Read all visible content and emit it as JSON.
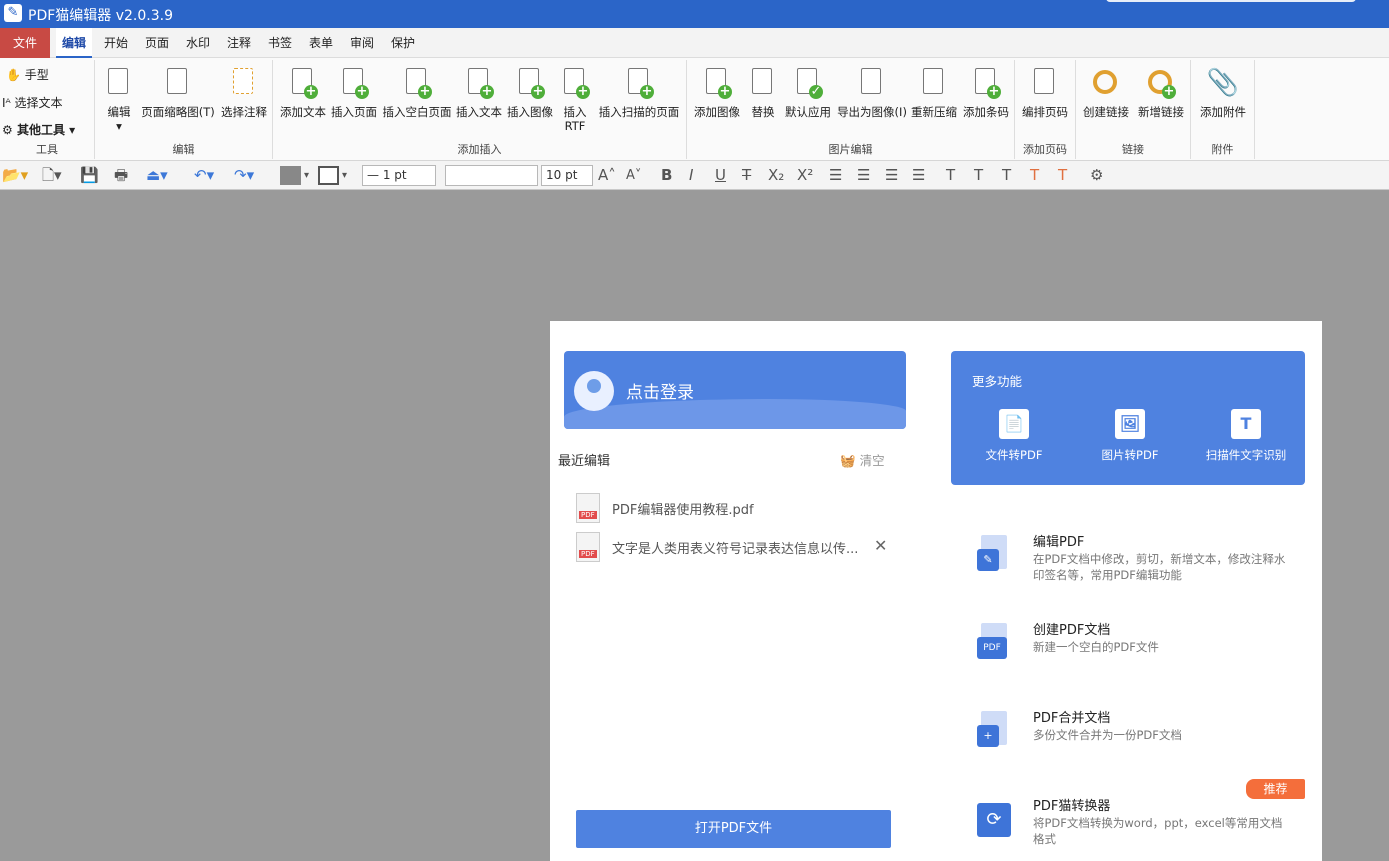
{
  "window": {
    "title": "PDF猫编辑器 v2.0.3.9"
  },
  "menu": {
    "tabs": [
      "文件",
      "编辑",
      "开始",
      "页面",
      "水印",
      "注释",
      "书签",
      "表单",
      "审阅",
      "保护"
    ]
  },
  "ribbon": {
    "tools": {
      "hand": "手型",
      "select_text": "选择文本",
      "other_tools": "其他工具",
      "label": "工具"
    },
    "edit": {
      "items": [
        "编辑",
        "页面缩略图(T)",
        "选择注释"
      ],
      "label": "编辑"
    },
    "insert": {
      "items": [
        "添加文本",
        "插入页面",
        "插入空白页面",
        "插入文本",
        "插入图像",
        "插入RTF",
        "插入扫描的页面"
      ],
      "label": "添加插入"
    },
    "image": {
      "items": [
        "添加图像",
        "替换",
        "默认应用",
        "导出为图像(I)",
        "重新压缩",
        "添加条码"
      ],
      "label": "图片编辑"
    },
    "pagenum": {
      "items": [
        "编排页码"
      ],
      "label": "添加页码"
    },
    "link": {
      "items": [
        "创建链接",
        "新增链接"
      ],
      "label": "链接"
    },
    "attach": {
      "items": [
        "添加附件"
      ],
      "label": "附件"
    }
  },
  "toolbar2": {
    "line_width": "— 1 pt",
    "font_size": "10 pt",
    "font_name": ""
  },
  "panel": {
    "login_text": "点击登录",
    "recent_title": "最近编辑",
    "clear_label": "清空",
    "recent_files": [
      "PDF编辑器使用教程.pdf",
      "文字是人类用表义符号记录表达信息以传..."
    ],
    "open_button": "打开PDF文件",
    "more_title": "更多功能",
    "more_items": [
      "文件转PDF",
      "图片转PDF",
      "扫描件文字识别"
    ],
    "features": [
      {
        "title": "编辑PDF",
        "desc": "在PDF文档中修改，剪切，新增文本，修改注释水印签名等，常用PDF编辑功能"
      },
      {
        "title": "创建PDF文档",
        "desc": "新建一个空白的PDF文件"
      },
      {
        "title": "PDF合并文档",
        "desc": "多份文件合并为一份PDF文档"
      },
      {
        "title": "PDF猫转换器",
        "desc": "将PDF文档转换为word，ppt，excel等常用文档格式"
      }
    ],
    "badge": "推荐"
  }
}
